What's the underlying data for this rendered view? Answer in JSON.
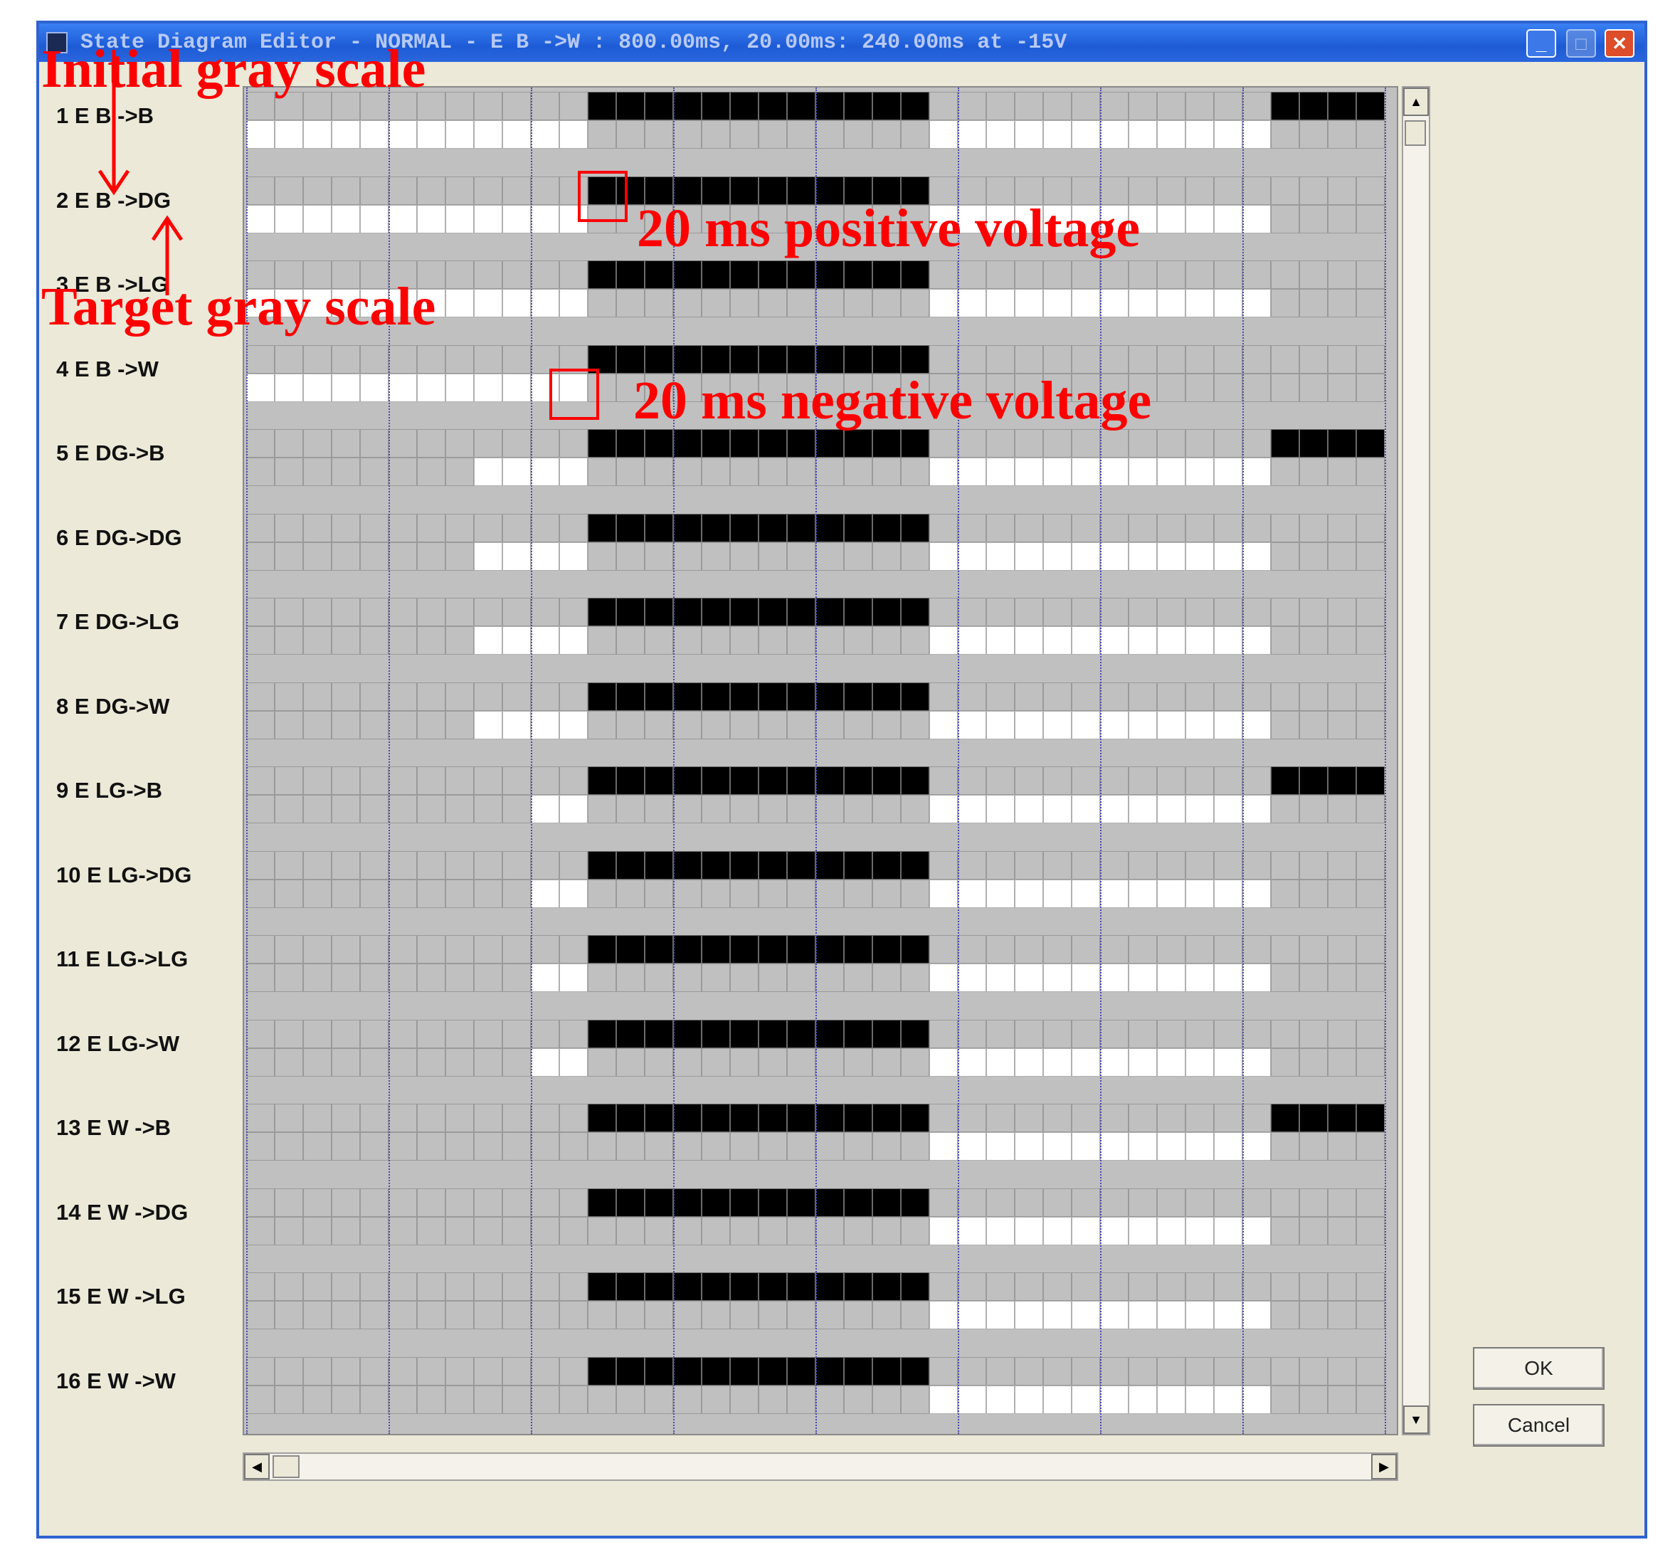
{
  "window": {
    "title": "State Diagram Editor - NORMAL - E B ->W : 800.00ms, 20.00ms: 240.00ms at -15V",
    "controls": {
      "minimize": "_",
      "maximize": "□",
      "close": "✕"
    }
  },
  "rows": [
    {
      "label": "1 E B ->B",
      "black": [
        [
          12,
          23
        ],
        [
          36,
          39
        ]
      ],
      "white": [
        [
          0,
          11
        ],
        [
          24,
          35
        ]
      ]
    },
    {
      "label": "2 E B ->DG",
      "black": [
        [
          12,
          23
        ]
      ],
      "white": [
        [
          0,
          11
        ],
        [
          24,
          35
        ]
      ]
    },
    {
      "label": "3 E B ->LG",
      "black": [
        [
          12,
          23
        ]
      ],
      "white": [
        [
          0,
          11
        ],
        [
          24,
          35
        ]
      ]
    },
    {
      "label": "4 E B ->W",
      "black": [
        [
          12,
          23
        ]
      ],
      "white": [
        [
          0,
          11
        ]
      ]
    },
    {
      "label": "5 E DG->B",
      "black": [
        [
          12,
          23
        ],
        [
          36,
          39
        ]
      ],
      "white": [
        [
          8,
          11
        ],
        [
          24,
          35
        ]
      ]
    },
    {
      "label": "6 E DG->DG",
      "black": [
        [
          12,
          23
        ]
      ],
      "white": [
        [
          8,
          11
        ],
        [
          24,
          35
        ]
      ]
    },
    {
      "label": "7 E DG->LG",
      "black": [
        [
          12,
          23
        ]
      ],
      "white": [
        [
          8,
          11
        ],
        [
          24,
          35
        ]
      ]
    },
    {
      "label": "8 E DG->W",
      "black": [
        [
          12,
          23
        ]
      ],
      "white": [
        [
          8,
          11
        ],
        [
          24,
          35
        ]
      ]
    },
    {
      "label": "9 E LG->B",
      "black": [
        [
          12,
          23
        ],
        [
          36,
          39
        ]
      ],
      "white": [
        [
          10,
          11
        ],
        [
          24,
          35
        ]
      ]
    },
    {
      "label": "10 E LG->DG",
      "black": [
        [
          12,
          23
        ]
      ],
      "white": [
        [
          10,
          11
        ],
        [
          24,
          35
        ]
      ]
    },
    {
      "label": "11 E LG->LG",
      "black": [
        [
          12,
          23
        ]
      ],
      "white": [
        [
          10,
          11
        ],
        [
          24,
          35
        ]
      ]
    },
    {
      "label": "12 E LG->W",
      "black": [
        [
          12,
          23
        ]
      ],
      "white": [
        [
          10,
          11
        ],
        [
          24,
          35
        ]
      ]
    },
    {
      "label": "13 E W ->B",
      "black": [
        [
          12,
          23
        ],
        [
          36,
          39
        ]
      ],
      "white": [
        [
          24,
          35
        ]
      ]
    },
    {
      "label": "14 E W ->DG",
      "black": [
        [
          12,
          23
        ]
      ],
      "white": [
        [
          24,
          35
        ]
      ]
    },
    {
      "label": "15 E W ->LG",
      "black": [
        [
          12,
          23
        ]
      ],
      "white": [
        [
          24,
          35
        ]
      ]
    },
    {
      "label": "16 E W ->W",
      "black": [
        [
          12,
          23
        ]
      ],
      "white": [
        [
          24,
          35
        ]
      ]
    }
  ],
  "grid": {
    "frames": 40,
    "major_every": 5
  },
  "buttons": {
    "ok": "OK",
    "cancel": "Cancel"
  },
  "scrollbars": {
    "up": "▲",
    "down": "▼",
    "left": "◀",
    "right": "▶"
  },
  "annotations": {
    "initial": "Initial gray scale",
    "target": "Target gray scale",
    "positive": "20 ms positive voltage",
    "negative": "20 ms negative voltage",
    "color": "#ff0000"
  }
}
